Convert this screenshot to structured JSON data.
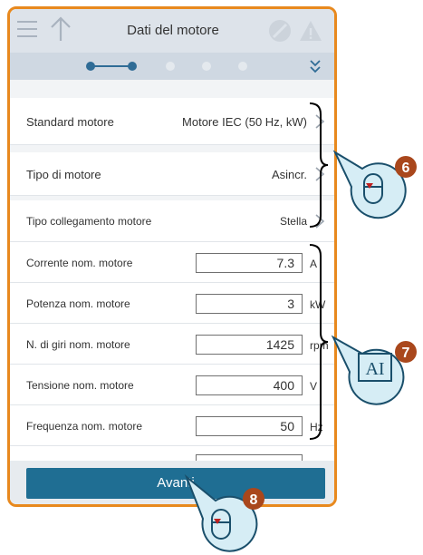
{
  "header": {
    "title": "Dati del motore"
  },
  "rows_select": [
    {
      "label": "Standard motore",
      "value": "Motore IEC (50 Hz, kW)"
    },
    {
      "label": "Tipo di motore",
      "value": "Asincr."
    },
    {
      "label": "Tipo collegamento motore",
      "value": "Stella"
    }
  ],
  "rows_input": [
    {
      "label": "Corrente nom. motore",
      "value": "7.3",
      "unit": "A"
    },
    {
      "label": "Potenza nom. motore",
      "value": "3",
      "unit": "kW"
    },
    {
      "label": "N. di giri nom. motore",
      "value": "1425",
      "unit": "rpm"
    },
    {
      "label": "Tensione nom. motore",
      "value": "400",
      "unit": "V"
    },
    {
      "label": "Frequenza nom. motore",
      "value": "50",
      "unit": "Hz"
    }
  ],
  "footer": {
    "button_label": "Avanti"
  },
  "callouts": {
    "c6": "6",
    "c7": "7",
    "c8": "8",
    "ai_text": "AI"
  },
  "colors": {
    "accent": "#e8891e",
    "primary": "#1f6e93",
    "callout": "#a9471c"
  }
}
